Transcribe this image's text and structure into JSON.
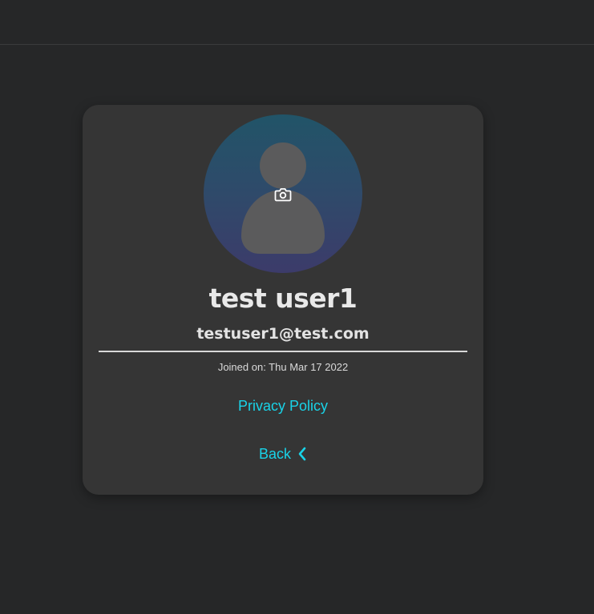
{
  "profile": {
    "name": "test user1",
    "email": "testuser1@test.com",
    "joined": "Joined on: Thu Mar 17 2022"
  },
  "links": {
    "privacy": "Privacy Policy",
    "back": "Back"
  },
  "icons": {
    "avatar": "user-silhouette-icon",
    "camera": "camera-icon",
    "back": "chevron-left-icon"
  },
  "colors": {
    "page_background": "#262728",
    "card_background": "#353535",
    "link": "#19d3e8",
    "avatar_gradient_top": "#215468",
    "avatar_gradient_bottom": "#3c3b6a"
  }
}
